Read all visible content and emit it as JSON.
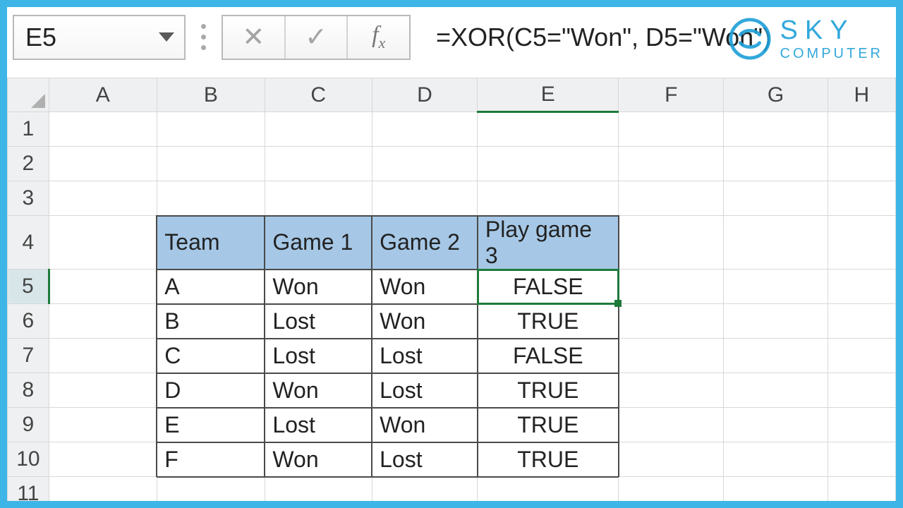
{
  "namebox": {
    "value": "E5"
  },
  "formula_bar": {
    "formula": "=XOR(C5=\"Won\", D5=\"Won\")"
  },
  "logo": {
    "line1": "SKY",
    "line2": "COMPUTER"
  },
  "columns": [
    "A",
    "B",
    "C",
    "D",
    "E",
    "F",
    "G",
    "H"
  ],
  "row_numbers": [
    "1",
    "2",
    "3",
    "4",
    "5",
    "6",
    "7",
    "8",
    "9",
    "10",
    "11"
  ],
  "selected_cell": "E5",
  "table": {
    "headers": {
      "team": "Team",
      "g1": "Game 1",
      "g2": "Game 2",
      "g3": "Play game 3"
    },
    "rows": [
      {
        "team": "A",
        "g1": "Won",
        "g2": "Won",
        "g3": "FALSE"
      },
      {
        "team": "B",
        "g1": "Lost",
        "g2": "Won",
        "g3": "TRUE"
      },
      {
        "team": "C",
        "g1": "Lost",
        "g2": "Lost",
        "g3": "FALSE"
      },
      {
        "team": "D",
        "g1": "Won",
        "g2": "Lost",
        "g3": "TRUE"
      },
      {
        "team": "E",
        "g1": "Lost",
        "g2": "Won",
        "g3": "TRUE"
      },
      {
        "team": "F",
        "g1": "Won",
        "g2": "Lost",
        "g3": "TRUE"
      }
    ]
  }
}
